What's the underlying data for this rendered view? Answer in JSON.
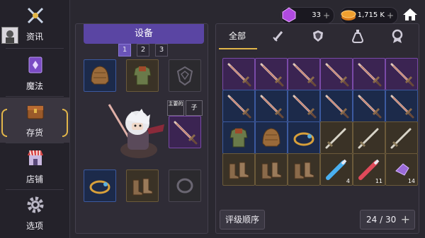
{
  "sidebar": {
    "items": [
      {
        "label": "资讯",
        "icon": "crossed-swords-icon"
      },
      {
        "label": "魔法",
        "icon": "spellbook-icon"
      },
      {
        "label": "存货",
        "icon": "chest-icon"
      },
      {
        "label": "店铺",
        "icon": "shop-icon"
      },
      {
        "label": "选项",
        "icon": "gear-icon"
      }
    ]
  },
  "equipment": {
    "title": "设备",
    "tabs": [
      "1",
      "2",
      "3"
    ],
    "main_tag_line1": "主要的",
    "main_tag_line2": "子"
  },
  "currency": {
    "gems": "33",
    "gold": "1,715 K"
  },
  "inventory": {
    "tab_all": "全部",
    "tab_icons": [
      "sword-icon",
      "shield-icon",
      "potion-icon",
      "medal-icon"
    ],
    "quantities": {
      "potion_blue": "4",
      "potion_red": "11",
      "crystal": "14"
    },
    "sort_label": "评级顺序",
    "capacity": "24 / 30"
  },
  "colors": {
    "accent": "#5a45a3",
    "highlight": "#e2b64a",
    "rarity_purple": "#7a4aa8",
    "rarity_blue": "#3c5aa0",
    "rarity_brown": "#6b5a3a"
  }
}
